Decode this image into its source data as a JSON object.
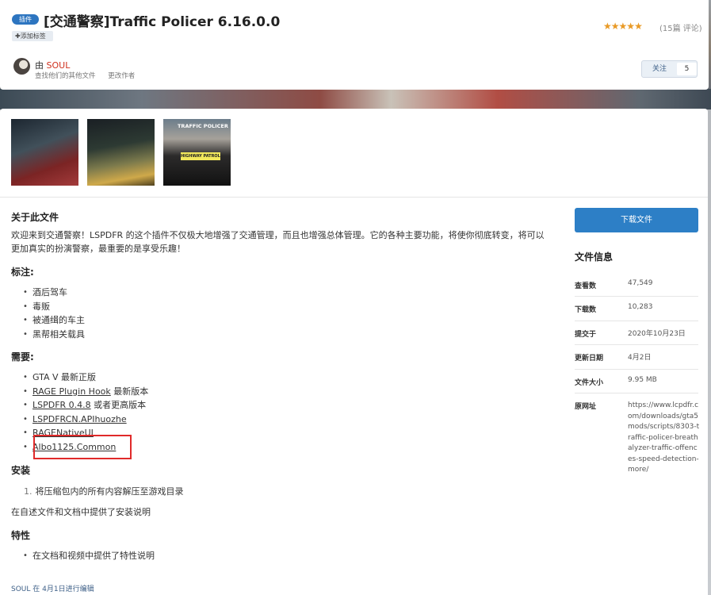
{
  "header": {
    "badge": "插件",
    "title": "[交通警察]Traffic Policer 6.16.0.0",
    "add_tag": "✚添加标签",
    "rating_stars": 4.5,
    "reviews": "(15篇 评论)",
    "by_prefix": "由",
    "author": "SOUL",
    "links": [
      "查找他们的其他文件",
      "更改作者"
    ],
    "follow_label": "关注",
    "follow_count": "5"
  },
  "gallery": {
    "thumb3_caption": "TRAFFIC POLICER",
    "thumb3_plate": "HIGHWAY PATROL"
  },
  "main": {
    "about_heading": "关于此文件",
    "intro_line1": "欢迎来到交通警察！LSPDFR 的这个插件不仅极大地增强了交通管理，而且也增强总体管理。它的各种主要功能，将使你彻底转变，将可以",
    "intro_line2": "更加真实的扮演警察，最重要的是享受乐趣！",
    "notes_heading": "标注:",
    "notes": [
      "酒后驾车",
      "毒贩",
      "被通缉的车主",
      "黑帮相关载具"
    ],
    "req_heading": "需要:",
    "requirements": [
      {
        "link": "",
        "text": "GTA V 最新正版"
      },
      {
        "link": "RAGE Plugin Hook",
        "text": " 最新版本"
      },
      {
        "link": "LSPDFR 0.4.8",
        "text": " 或者更高版本"
      },
      {
        "link": "LSPDFRCN.APIhuozhe",
        "text": ""
      },
      {
        "link": "RAGENativeUI",
        "text": ""
      },
      {
        "link": "Albo1125.Common",
        "text": ""
      }
    ],
    "install_heading": "安装",
    "install_num": "1.",
    "install_step": "将压缩包内的所有内容解压至游戏目录",
    "install_note": "在自述文件和文档中提供了安装说明",
    "features_heading": "特性",
    "features": [
      "在文档和视频中提供了特性说明"
    ],
    "edit_note": "SOUL 在 4月1日进行编辑"
  },
  "sidebar": {
    "download": "下载文件",
    "info_title": "文件信息",
    "rows": [
      {
        "key": "查看数",
        "value": "47,549"
      },
      {
        "key": "下载数",
        "value": "10,283"
      },
      {
        "key": "提交于",
        "value": "2020年10月23日"
      },
      {
        "key": "更新日期",
        "value": "4月2日"
      },
      {
        "key": "文件大小",
        "value": "9.95 MB"
      }
    ],
    "url_key": "原网址",
    "url_value": "https://www.lcpdfr.com/downloads/gta5mods/scripts/8303-traffic-policer-breathalyzer-traffic-offences-speed-detection-more/"
  },
  "colors": {
    "accent_blue": "#2d7fc6",
    "author_red": "#d0321f",
    "star_orange": "#e99a26",
    "highlight_box": "#e02a2a"
  }
}
